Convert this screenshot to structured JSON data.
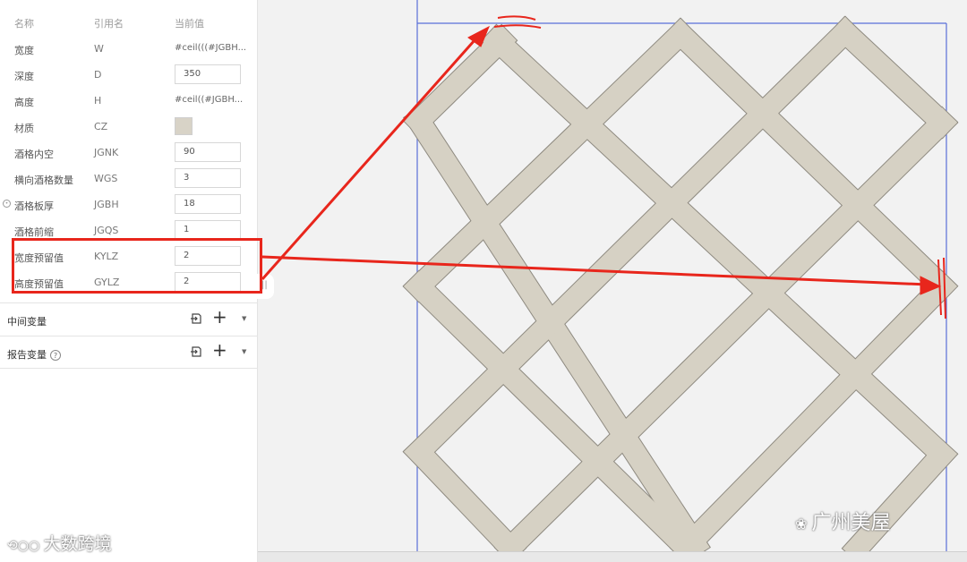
{
  "panel": {
    "headers": {
      "name": "名称",
      "ref": "引用名",
      "value": "当前值"
    },
    "rows": [
      {
        "name": "宽度",
        "ref": "W",
        "value": "#ceil(((#JGBH...",
        "kind": "text"
      },
      {
        "name": "深度",
        "ref": "D",
        "value": "350",
        "kind": "input"
      },
      {
        "name": "高度",
        "ref": "H",
        "value": "#ceil((#JGBH...",
        "kind": "text"
      },
      {
        "name": "材质",
        "ref": "CZ",
        "value": "",
        "kind": "swatch"
      },
      {
        "name": "酒格内空",
        "ref": "JGNK",
        "value": "90",
        "kind": "input"
      },
      {
        "name": "横向酒格数量",
        "ref": "WGS",
        "value": "3",
        "kind": "input"
      },
      {
        "name": "酒格板厚",
        "ref": "JGBH",
        "value": "18",
        "kind": "input"
      },
      {
        "name": "酒格前缩",
        "ref": "JGQS",
        "value": "1",
        "kind": "input"
      },
      {
        "name": "宽度预留值",
        "ref": "KYLZ",
        "value": "2",
        "kind": "input"
      },
      {
        "name": "高度预留值",
        "ref": "GYLZ",
        "value": "2",
        "kind": "input"
      }
    ],
    "sections": [
      {
        "title": "中间变量",
        "help": ""
      },
      {
        "title": "报告变量",
        "help": "?"
      }
    ],
    "swatch_color": "#d8d3c7",
    "handle_glyph": "||"
  },
  "watermarks": {
    "left": "大数跨境",
    "right": "广州美屋"
  },
  "colors": {
    "annotation_red": "#e8261c",
    "guide_blue": "#5a6fd8",
    "wood": "#d6d1c4"
  }
}
